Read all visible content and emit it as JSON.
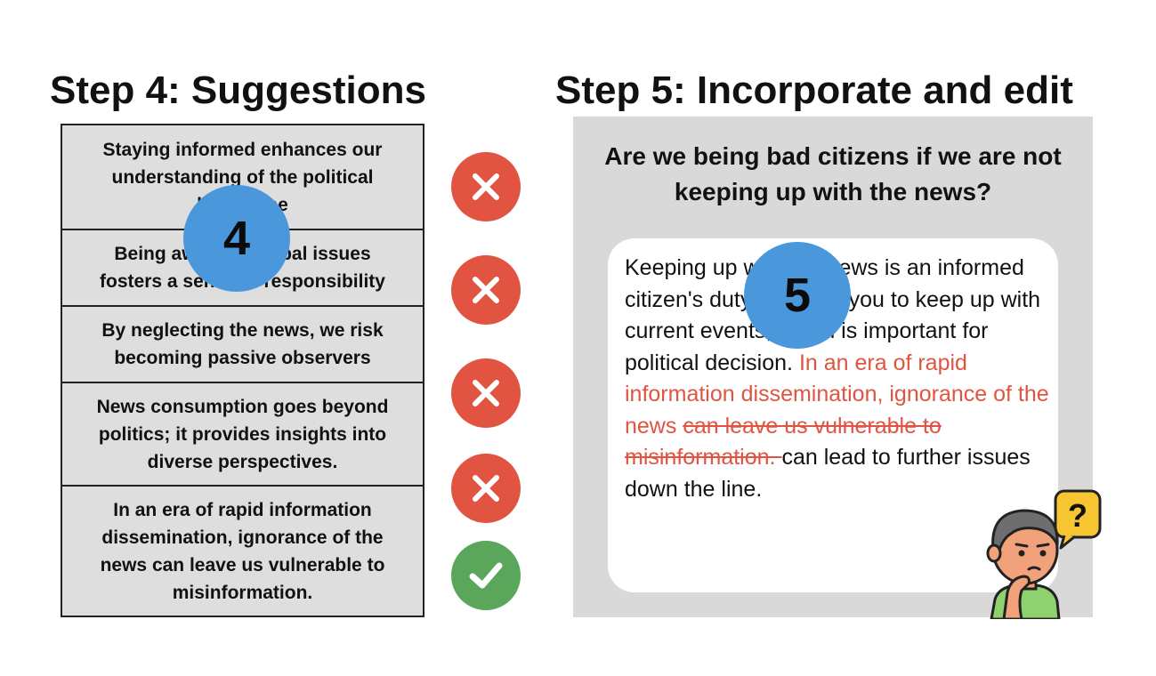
{
  "step4": {
    "title": "Step 4: Suggestions",
    "badge": "4",
    "suggestions": [
      {
        "lines": [
          "Staying informed enhances our",
          "understanding of the political",
          "landscape"
        ],
        "status": "rejected"
      },
      {
        "lines": [
          "Being aware of global issues",
          "fosters a sense of responsibility"
        ],
        "status": "rejected"
      },
      {
        "lines": [
          "By neglecting the news, we risk",
          "becoming passive observers"
        ],
        "status": "rejected"
      },
      {
        "lines": [
          "News consumption goes beyond",
          "politics; it provides insights into",
          "diverse perspectives."
        ],
        "status": "rejected"
      },
      {
        "lines": [
          "In an era of rapid information",
          "dissemination, ignorance of the",
          "news can leave us vulnerable to",
          "misinformation."
        ],
        "status": "accepted"
      }
    ]
  },
  "step5": {
    "title": "Step 5: Incorporate and edit",
    "badge": "5",
    "question_lines": [
      "Are we being bad citizens if we are not",
      "keeping up with the news?"
    ],
    "paragraph": {
      "original": "Keeping up with the news is an informed citizen's duty. It allows you to keep up with current events, which is important for political decision. ",
      "inserted": "In an era of rapid information dissemination, ignorance of the news ",
      "deleted": "can leave us vulnerable to misinformation. ",
      "added": "can lead to further issues down the line."
    },
    "illustration": {
      "icon": "thinking-person-icon",
      "bubble_text": "?"
    }
  },
  "colors": {
    "reject": "#e05441",
    "accept": "#5aa65a",
    "badge": "#4a97db",
    "panel": "#d9d9d9",
    "cell": "#dedede"
  }
}
